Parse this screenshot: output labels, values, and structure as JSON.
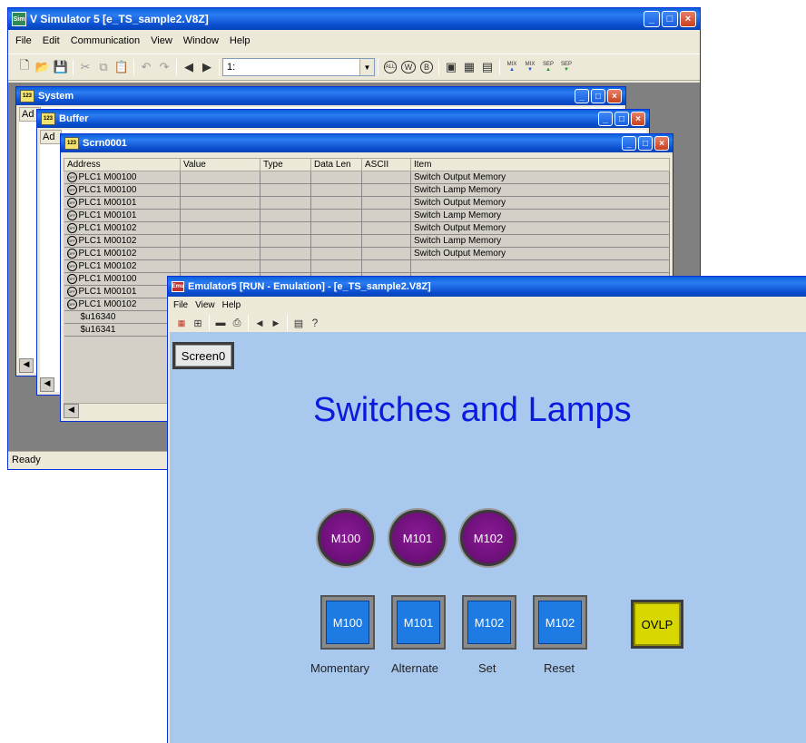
{
  "sim_window": {
    "title": "V Simulator 5 [e_TS_sample2.V8Z]",
    "icon_text": "Sim",
    "menu": [
      "File",
      "Edit",
      "Communication",
      "View",
      "Window",
      "Help"
    ],
    "address_box": "1:",
    "status": "Ready",
    "toolbar_text": {
      "all": "ALL",
      "w": "W",
      "b": "B",
      "mix1": "MIX",
      "mix2": "MIX",
      "sep1": "SEP",
      "sep2": "SEP"
    }
  },
  "system_window": {
    "title": "System",
    "col_stub": "Ad"
  },
  "buffer_window": {
    "title": "Buffer",
    "col_stub": "Ad"
  },
  "scrn_window": {
    "title": "Scrn0001",
    "columns": [
      "Address",
      "Value",
      "Type",
      "Data Len",
      "ASCII",
      "Item"
    ],
    "rows": [
      {
        "address": "PLC1 M00100",
        "item": "Switch Output Memory"
      },
      {
        "address": "PLC1 M00100",
        "item": "Switch Lamp Memory"
      },
      {
        "address": "PLC1 M00101",
        "item": "Switch Output Memory"
      },
      {
        "address": "PLC1 M00101",
        "item": "Switch Lamp Memory"
      },
      {
        "address": "PLC1 M00102",
        "item": "Switch Output Memory"
      },
      {
        "address": "PLC1 M00102",
        "item": "Switch Lamp Memory"
      },
      {
        "address": "PLC1 M00102",
        "item": "Switch Output Memory"
      },
      {
        "address": "PLC1 M00102",
        "item": ""
      },
      {
        "address": "PLC1 M00100",
        "item": ""
      },
      {
        "address": "PLC1 M00101",
        "item": ""
      },
      {
        "address": "PLC1 M00102",
        "item": ""
      },
      {
        "address": "$u16340",
        "item": ""
      },
      {
        "address": "$u16341",
        "item": ""
      }
    ],
    "off_icon_text": "OFF"
  },
  "emulator": {
    "title": "Emulator5 [RUN - Emulation] - [e_TS_sample2.V8Z]",
    "icon_text": "Emu",
    "menu": [
      "File",
      "View",
      "Help"
    ],
    "screen_button": "Screen0",
    "heading": "Switches and Lamps",
    "lamps": [
      "M100",
      "M101",
      "M102"
    ],
    "switches": [
      {
        "label": "M100",
        "caption": "Momentary"
      },
      {
        "label": "M101",
        "caption": "Alternate"
      },
      {
        "label": "M102",
        "caption": "Set"
      },
      {
        "label": "M102",
        "caption": "Reset"
      }
    ],
    "ovlp": "OVLP",
    "colors": {
      "background": "#a9c8ee",
      "heading": "#0a1adf",
      "lamp": "#7a1488",
      "switch": "#1e7be3",
      "ovlp": "#d8d800"
    }
  }
}
